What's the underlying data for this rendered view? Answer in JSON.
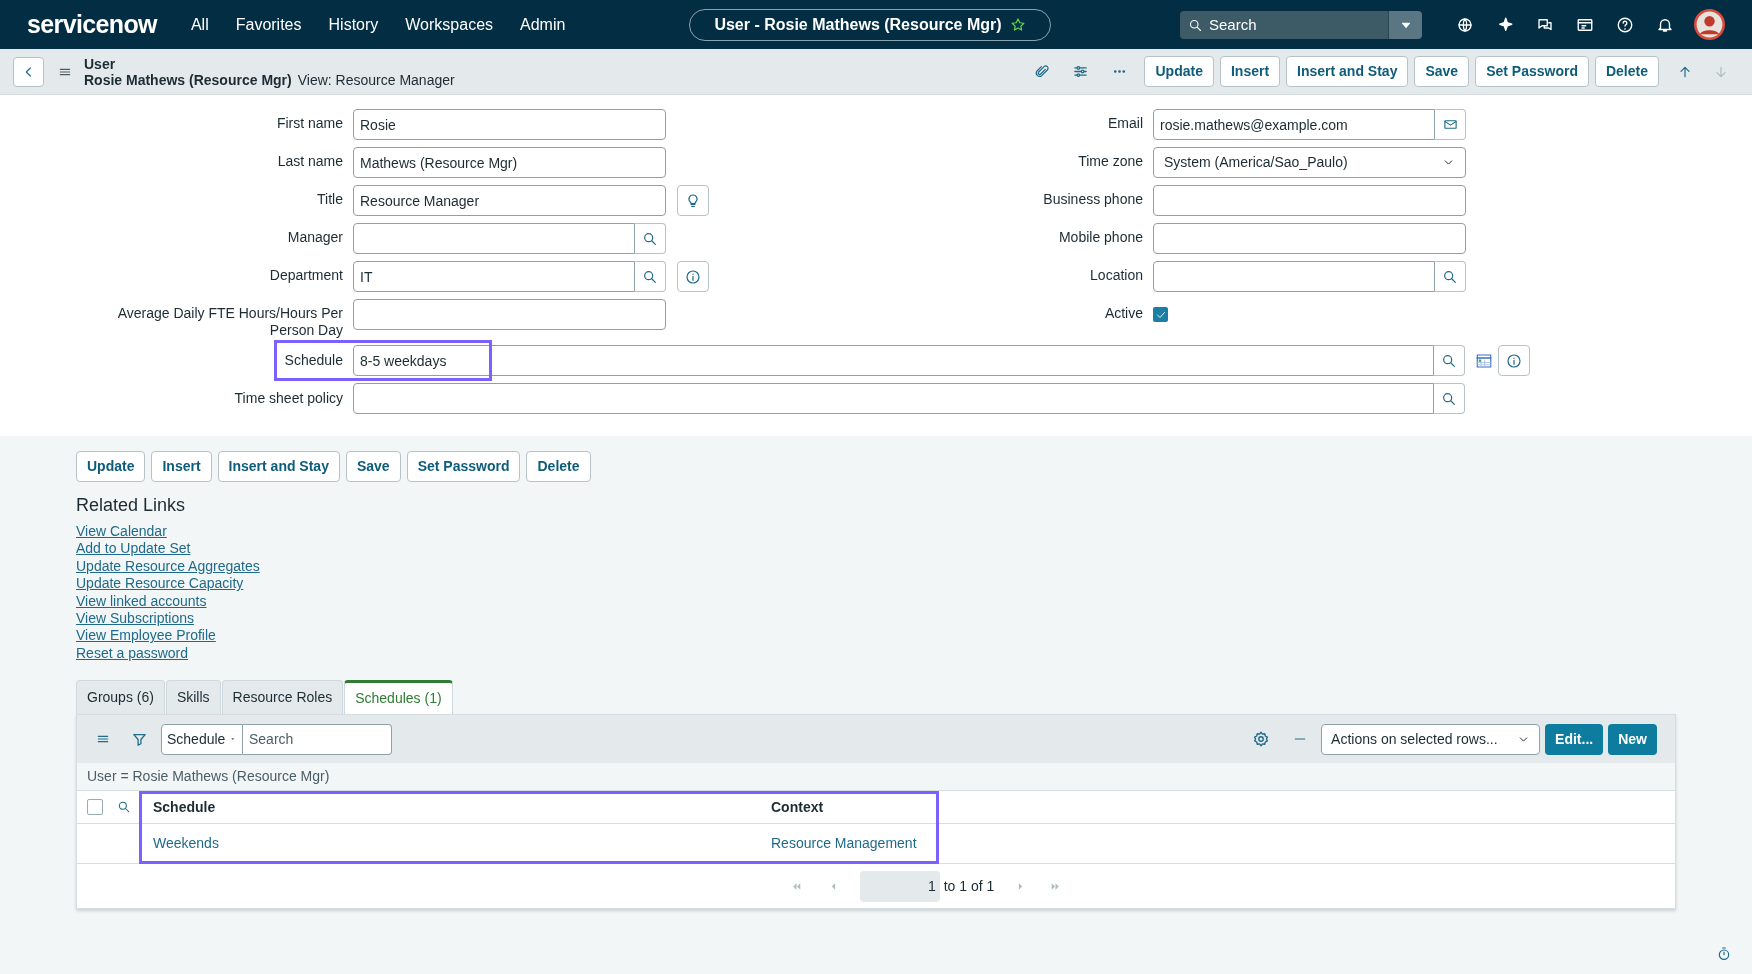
{
  "top_nav": {
    "logo": "servicenow",
    "menu": [
      "All",
      "Favorites",
      "History",
      "Workspaces",
      "Admin"
    ],
    "record_pill": "User - Rosie Mathews (Resource Mgr)",
    "search": {
      "placeholder": "Search"
    }
  },
  "header": {
    "table": "User",
    "record": "Rosie Mathews (Resource Mgr)",
    "view": "View: Resource Manager",
    "buttons": [
      "Update",
      "Insert",
      "Insert and Stay",
      "Save",
      "Set Password",
      "Delete"
    ]
  },
  "form": {
    "left": [
      {
        "label": "First name",
        "kind": "text",
        "value": "Rosie"
      },
      {
        "label": "Last name",
        "kind": "text",
        "value": "Mathews (Resource Mgr)"
      },
      {
        "label": "Title",
        "kind": "text",
        "value": "Resource Manager",
        "suggestion_button": true
      },
      {
        "label": "Manager",
        "kind": "reference"
      },
      {
        "label": "Department",
        "kind": "reference",
        "value": "IT",
        "info_button": true
      },
      {
        "label": "Average Daily FTE Hours/Hours Per Person Day",
        "kind": "text"
      }
    ],
    "right": [
      {
        "label": "Email",
        "kind": "email",
        "value": "rosie.mathews@example.com"
      },
      {
        "label": "Time zone",
        "kind": "select",
        "value": "System (America/Sao_Paulo)"
      },
      {
        "label": "Business phone",
        "kind": "text"
      },
      {
        "label": "Mobile phone",
        "kind": "text"
      },
      {
        "label": "Location",
        "kind": "reference"
      },
      {
        "label": "Active",
        "kind": "checkbox",
        "checked": true
      }
    ],
    "wide": [
      {
        "label": "Schedule",
        "kind": "reference",
        "value": "8-5 weekdays",
        "calendar_button": true,
        "info_button": true,
        "highlighted": true
      },
      {
        "label": "Time sheet policy",
        "kind": "reference",
        "highlighted": false
      }
    ]
  },
  "bottom_buttons": [
    "Update",
    "Insert",
    "Insert and Stay",
    "Save",
    "Set Password",
    "Delete"
  ],
  "related_links": {
    "title": "Related Links",
    "links": [
      "View Calendar",
      "Add to Update Set",
      "Update Resource Aggregates",
      "Update Resource Capacity",
      "View linked accounts",
      "View Subscriptions",
      "View Employee Profile",
      "Reset a password"
    ]
  },
  "related_list": {
    "tabs": [
      {
        "label": "Groups (6)",
        "selected": false
      },
      {
        "label": "Skills",
        "selected": false
      },
      {
        "label": "Resource Roles",
        "selected": false
      },
      {
        "label": "Schedules (1)",
        "selected": true
      }
    ],
    "search_field": "Schedule",
    "search": {
      "placeholder": "Search"
    },
    "actions": "Actions on selected rows...",
    "buttons": [
      "Edit...",
      "New"
    ],
    "breadcrumb": "User = Rosie Mathews (Resource Mgr)",
    "select_all": {
      "checked": false
    },
    "columns": [
      "Schedule",
      "Context"
    ],
    "highlighted": true,
    "rows": [
      {
        "cells": [
          "Weekends",
          "Resource Management"
        ]
      }
    ],
    "pagination": {
      "page": "1",
      "range": "to 1 of 1"
    }
  }
}
